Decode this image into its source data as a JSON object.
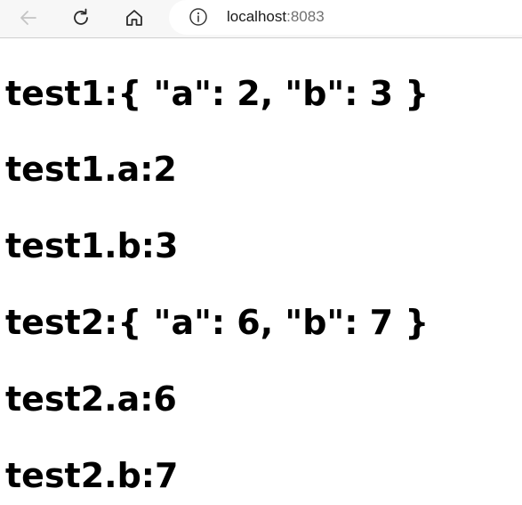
{
  "browser": {
    "url_host": "localhost",
    "url_port": ":8083"
  },
  "main": {
    "lines": [
      "test1:{ \"a\": 2, \"b\": 3 }",
      "test1.a:2",
      "test1.b:3",
      "test2:{ \"a\": 6, \"b\": 7 }",
      "test2.a:6",
      "test2.b:7"
    ]
  },
  "icons": {
    "back": "back-arrow-icon",
    "reload": "reload-icon",
    "home": "home-icon",
    "info": "info-icon"
  }
}
